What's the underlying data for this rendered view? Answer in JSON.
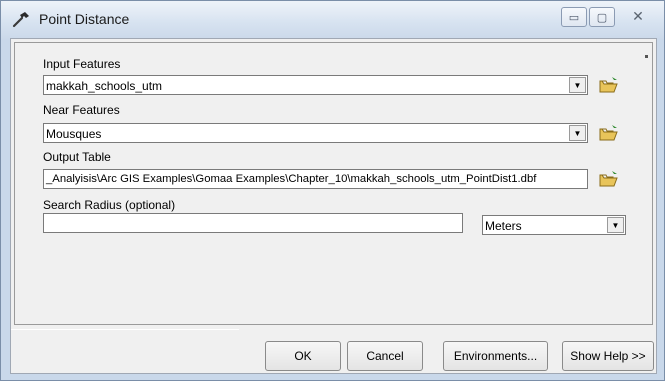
{
  "window": {
    "title": "Point Distance",
    "controls": {
      "minimize": "▭",
      "maximize": "▢",
      "close": "✕"
    }
  },
  "form": {
    "input_features": {
      "label": "Input Features",
      "value": "makkah_schools_utm"
    },
    "near_features": {
      "label": "Near Features",
      "value": "Mousques"
    },
    "output_table": {
      "label": "Output Table",
      "value": "_Analyisis\\Arc GIS Examples\\Gomaa Examples\\Chapter_10\\makkah_schools_utm_PointDist1.dbf"
    },
    "search_radius": {
      "label": "Search Radius (optional)",
      "value": "",
      "units": "Meters"
    }
  },
  "buttons": {
    "ok": "OK",
    "cancel": "Cancel",
    "environments": "Environments...",
    "show_help": "Show Help >>"
  },
  "icons": {
    "title": "hammer-icon",
    "browse": "open-folder-icon",
    "dropdown": "dropdown-arrow-icon"
  },
  "colors": {
    "title_bar": "#d6e2f0",
    "dialog_face": "#f0f0f0",
    "folder_yellow": "#e8c45a"
  }
}
